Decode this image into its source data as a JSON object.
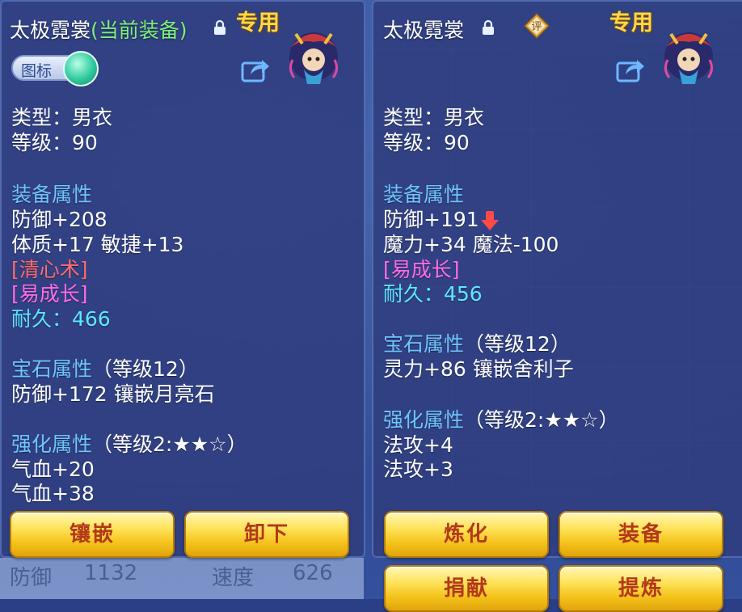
{
  "left_panel": {
    "title": "太极霓裳",
    "equipped_tag": "(当前装备)",
    "special_label": "专用",
    "toggle_label": "图标",
    "lines": {
      "type": "类型：男衣",
      "level": "等级：90",
      "attr_header": "装备属性",
      "defense": "防御+208",
      "stats": "体质+17 敏捷+13",
      "skill": "[清心术]",
      "trait": "[易成长]",
      "durability": "耐久：466",
      "gem_header": "宝石属性",
      "gem_level": "（等级12）",
      "gem_effect": "防御+172 镶嵌月亮石",
      "enhance_header": "强化属性",
      "enhance_level": "（等级2:★★☆）",
      "enhance_1": "气血+20",
      "enhance_2": "气血+38"
    },
    "buttons": {
      "inlay": "镶嵌",
      "unequip": "卸下"
    }
  },
  "right_panel": {
    "title": "太极霓裳",
    "rate_icon_label": "评",
    "special_label": "专用",
    "lines": {
      "type": "类型：男衣",
      "level": "等级：90",
      "attr_header": "装备属性",
      "defense": "防御+191",
      "stats": "魔力+34 魔法-100",
      "trait": "[易成长]",
      "durability": "耐久：456",
      "gem_header": "宝石属性",
      "gem_level": "（等级12）",
      "gem_effect": "灵力+86 镶嵌舍利子",
      "enhance_header": "强化属性",
      "enhance_level": "（等级2:★★☆）",
      "enhance_1": "法攻+4",
      "enhance_2": "法攻+3"
    },
    "buttons": {
      "refine": "炼化",
      "equip": "装备",
      "donate": "捐献",
      "extract": "提炼"
    }
  },
  "background": {
    "stats": {
      "defense_label": "防御",
      "defense_value": "1132",
      "speed_label": "速度",
      "speed_value": "626"
    }
  },
  "colors": {
    "panel": "#303e80",
    "section": "#6fc4ff",
    "equipped": "#7ef07a",
    "special": "#ffd84a",
    "skill_red": "#ff6c6c",
    "trait_pink": "#ff6de8",
    "durability_cyan": "#5ee8ff",
    "button_text": "#b2381a"
  },
  "icons": [
    "lock-icon",
    "share-icon",
    "avatar-icon",
    "rate-icon",
    "down-arrow-icon",
    "toggle-knob-icon"
  ]
}
